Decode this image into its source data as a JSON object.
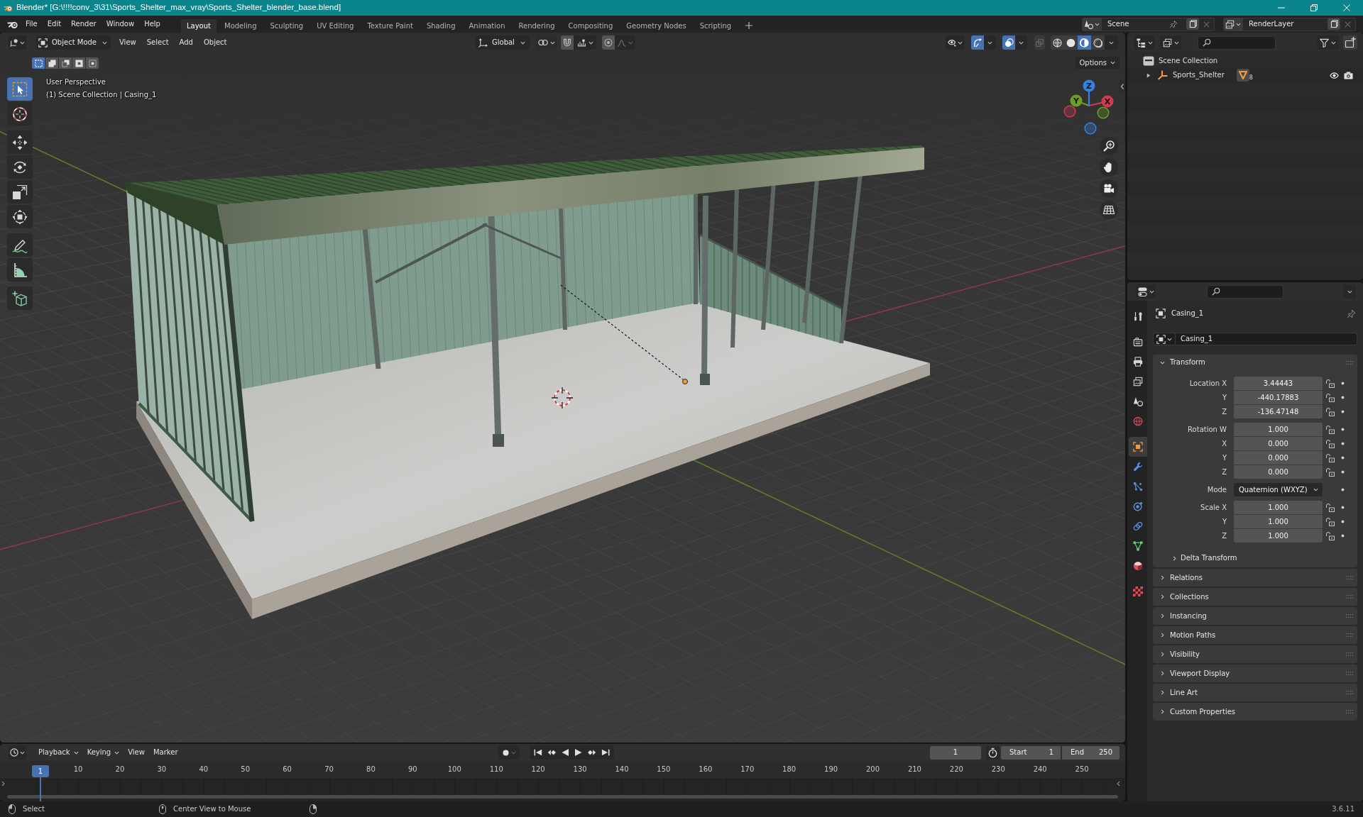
{
  "window": {
    "title": "Blender* [G:\\!!!!conv_3\\31\\Sports_Shelter_max_vray\\Sports_Shelter_blender_base.blend]"
  },
  "top_bar": {
    "menus": [
      "File",
      "Edit",
      "Render",
      "Window",
      "Help"
    ],
    "workspaces": [
      {
        "label": "Layout",
        "selected": true
      },
      {
        "label": "Modeling",
        "selected": false
      },
      {
        "label": "Sculpting",
        "selected": false
      },
      {
        "label": "UV Editing",
        "selected": false
      },
      {
        "label": "Texture Paint",
        "selected": false
      },
      {
        "label": "Shading",
        "selected": false
      },
      {
        "label": "Animation",
        "selected": false
      },
      {
        "label": "Rendering",
        "selected": false
      },
      {
        "label": "Compositing",
        "selected": false
      },
      {
        "label": "Geometry Nodes",
        "selected": false
      },
      {
        "label": "Scripting",
        "selected": false
      }
    ],
    "scene": "Scene",
    "view_layer": "RenderLayer"
  },
  "viewport": {
    "mode": "Object Mode",
    "menus": [
      "View",
      "Select",
      "Add",
      "Object"
    ],
    "orientation": "Global",
    "snap_on": false,
    "proportional_on": false,
    "gizmos_on": true,
    "overlays_on": true,
    "xray_on": false,
    "shading": [
      {
        "kind": "wireframe",
        "selected": false
      },
      {
        "kind": "solid",
        "selected": false
      },
      {
        "kind": "material",
        "selected": true
      },
      {
        "kind": "rendered",
        "selected": false
      }
    ],
    "select_modes": [
      {
        "kind": "set",
        "selected": true
      },
      {
        "kind": "extend",
        "selected": false
      },
      {
        "kind": "subtract",
        "selected": false
      },
      {
        "kind": "difference",
        "selected": false
      },
      {
        "kind": "intersect",
        "selected": false
      }
    ],
    "options": "Options",
    "tool_groups": [
      {
        "tools": [
          {
            "kind": "select",
            "selected": true
          },
          {
            "kind": "cursor",
            "selected": false
          }
        ]
      },
      {
        "tools": [
          {
            "kind": "move",
            "selected": false
          },
          {
            "kind": "rotate",
            "selected": false
          },
          {
            "kind": "scale",
            "selected": false
          },
          {
            "kind": "transform",
            "selected": false
          }
        ]
      },
      {
        "tools": [
          {
            "kind": "annotate",
            "selected": false
          },
          {
            "kind": "measure",
            "selected": false
          }
        ]
      },
      {
        "tools": [
          {
            "kind": "add_cube",
            "selected": false
          }
        ]
      }
    ],
    "info": [
      "User Perspective",
      "(1) Scene Collection | Casing_1"
    ],
    "gizmo_axes": [
      {
        "label": "X",
        "color": "#d5394f"
      },
      {
        "label": "Y",
        "color": "#6a9f23"
      },
      {
        "label": "Z",
        "color": "#2f83e3"
      }
    ]
  },
  "outliner": {
    "items": [
      {
        "label": "Scene Collection",
        "children": [
          {
            "label": "Sports_Shelter",
            "expanded": false,
            "badge": "8",
            "visible": true
          }
        ]
      }
    ]
  },
  "properties": {
    "tab_groups": [
      {
        "tabs": [
          {
            "kind": "tool",
            "selected": false
          }
        ]
      },
      {
        "tabs": [
          {
            "kind": "render",
            "selected": false
          },
          {
            "kind": "output",
            "selected": false
          },
          {
            "kind": "view_layer",
            "selected": false
          },
          {
            "kind": "scene",
            "selected": false
          },
          {
            "kind": "world",
            "selected": false
          }
        ]
      },
      {
        "tabs": [
          {
            "kind": "object",
            "selected": true
          },
          {
            "kind": "modifiers",
            "selected": false
          },
          {
            "kind": "particles",
            "selected": false
          },
          {
            "kind": "physics",
            "selected": false
          },
          {
            "kind": "constraints",
            "selected": false
          },
          {
            "kind": "data",
            "selected": false
          },
          {
            "kind": "material",
            "selected": false
          }
        ]
      },
      {
        "tabs": [
          {
            "kind": "texture",
            "selected": false
          }
        ]
      }
    ],
    "object": "Casing_1",
    "datablock": "Casing_1",
    "transform": {
      "title": "Transform",
      "expanded": true,
      "groups": [
        {
          "rows": [
            {
              "kind": "number",
              "label": "Location X",
              "value": "3.44443",
              "locked": false
            },
            {
              "kind": "number",
              "label": "Y",
              "value": "-440.17883",
              "locked": false
            },
            {
              "kind": "number",
              "label": "Z",
              "value": "-136.47148",
              "locked": false
            }
          ]
        },
        {
          "rows": [
            {
              "kind": "number",
              "label": "Rotation W",
              "value": "1.000",
              "locked": false
            },
            {
              "kind": "number",
              "label": "X",
              "value": "0.000",
              "locked": false
            },
            {
              "kind": "number",
              "label": "Y",
              "value": "0.000",
              "locked": false
            },
            {
              "kind": "number",
              "label": "Z",
              "value": "0.000",
              "locked": false
            }
          ]
        },
        {
          "rows": [
            {
              "kind": "dropdown",
              "label": "Mode",
              "value": "Quaternion (WXYZ)"
            }
          ]
        },
        {
          "rows": [
            {
              "kind": "number",
              "label": "Scale X",
              "value": "1.000",
              "locked": false
            },
            {
              "kind": "number",
              "label": "Y",
              "value": "1.000",
              "locked": false
            },
            {
              "kind": "number",
              "label": "Z",
              "value": "1.000",
              "locked": false
            }
          ]
        }
      ],
      "subpanels": [
        {
          "label": "Delta Transform",
          "expanded": false
        }
      ]
    },
    "panels": [
      {
        "label": "Relations",
        "expanded": false
      },
      {
        "label": "Collections",
        "expanded": false
      },
      {
        "label": "Instancing",
        "expanded": false
      },
      {
        "label": "Motion Paths",
        "expanded": false
      },
      {
        "label": "Visibility",
        "expanded": false
      },
      {
        "label": "Viewport Display",
        "expanded": false
      },
      {
        "label": "Line Art",
        "expanded": false
      },
      {
        "label": "Custom Properties",
        "expanded": false
      }
    ]
  },
  "timeline": {
    "menus": [
      {
        "label": "Playback",
        "kind": "dropdown"
      },
      {
        "label": "Keying",
        "kind": "dropdown"
      },
      {
        "label": "View",
        "kind": "menu"
      },
      {
        "label": "Marker",
        "kind": "menu"
      }
    ],
    "frame": "1",
    "start_label": "Start",
    "start": "1",
    "end_label": "End",
    "end": "250",
    "playhead": "1",
    "ticks": [
      "10",
      "20",
      "30",
      "40",
      "50",
      "60",
      "70",
      "80",
      "90",
      "100",
      "110",
      "120",
      "130",
      "140",
      "150",
      "160",
      "170",
      "180",
      "190",
      "200",
      "210",
      "220",
      "230",
      "240",
      "250"
    ]
  },
  "status_bar": {
    "hints": [
      "Select",
      "Center View to Mouse"
    ],
    "version": "3.6.11"
  }
}
